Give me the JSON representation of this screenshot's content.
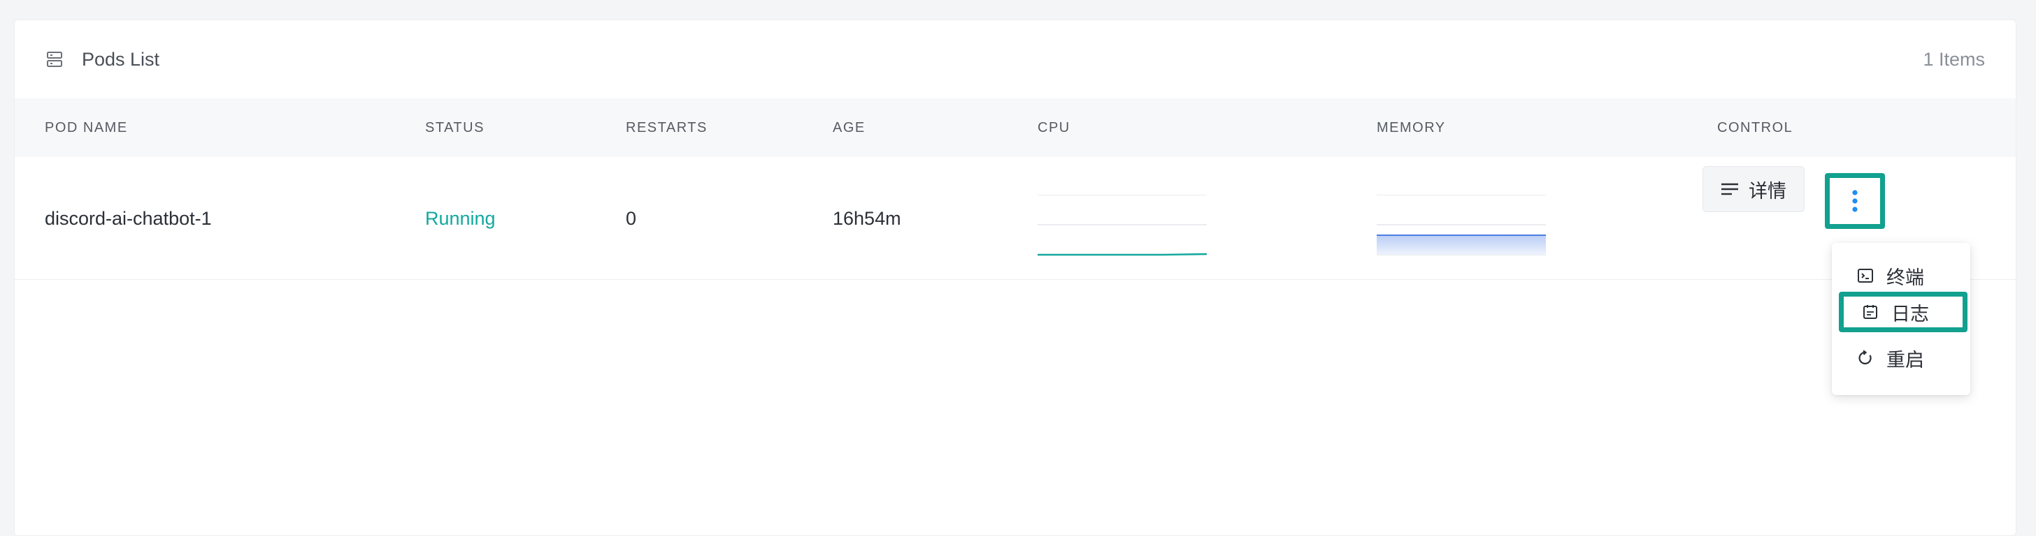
{
  "panel": {
    "title": "Pods List",
    "title_icon": "server-stack-icon",
    "items_count": "1 Items"
  },
  "table": {
    "headers": {
      "pod_name": "POD NAME",
      "status": "STATUS",
      "restarts": "RESTARTS",
      "age": "AGE",
      "cpu": "CPU",
      "memory": "MEMORY",
      "control": "CONTROL"
    },
    "rows": [
      {
        "pod_name": "discord-ai-chatbot-1",
        "status": "Running",
        "restarts": "0",
        "age": "16h54m",
        "detail_label": "详情",
        "detail_icon": "lines-icon",
        "more_icon": "vertical-ellipsis-icon"
      }
    ]
  },
  "dropdown": {
    "items": [
      {
        "label": "终端",
        "icon": "terminal-icon"
      },
      {
        "label": "日志",
        "icon": "log-calendar-icon"
      },
      {
        "label": "重启",
        "icon": "restart-icon"
      }
    ]
  },
  "colors": {
    "accent_teal": "#13a89e",
    "highlight_border": "#12a08f",
    "kebab_blue": "#1e8ef0",
    "memory_fill": "#c5d6f7",
    "memory_line": "#4a7fe0"
  }
}
